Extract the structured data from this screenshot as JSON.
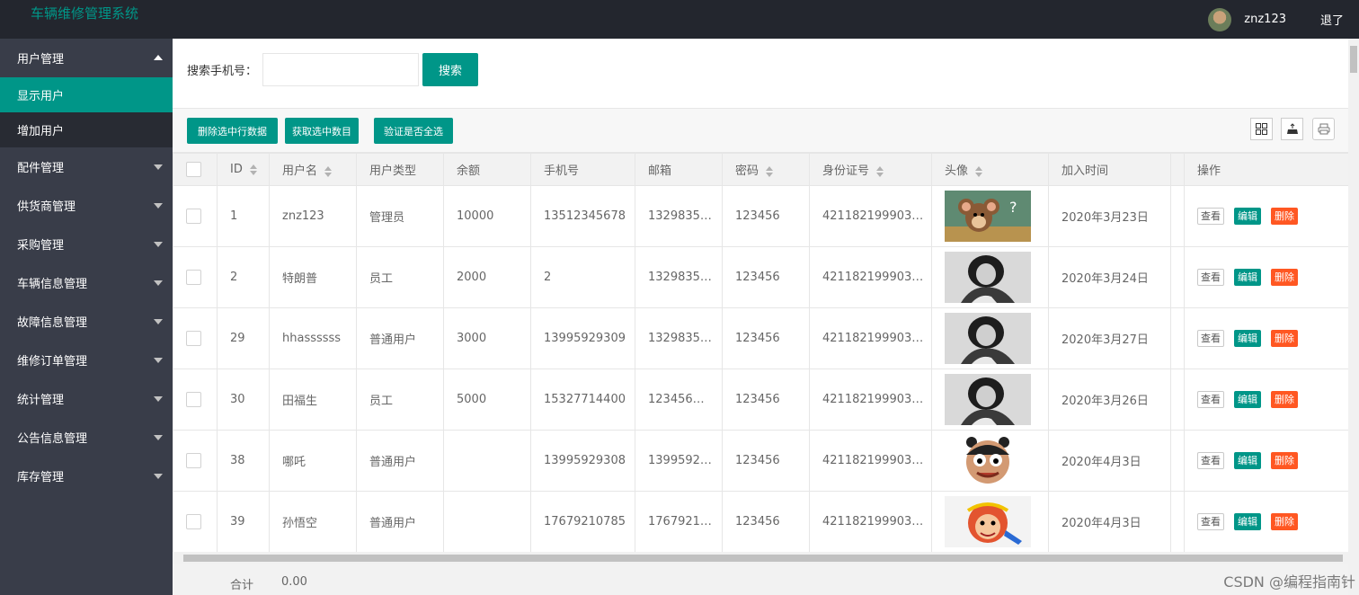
{
  "header": {
    "app_title": "车辆维修管理系统",
    "username": "znz123",
    "logout_label": "退了"
  },
  "sidebar": {
    "items": [
      {
        "label": "用户管理",
        "expanded": true,
        "children": [
          {
            "label": "显示用户",
            "active": true
          },
          {
            "label": "增加用户",
            "active": false
          }
        ]
      },
      {
        "label": "配件管理"
      },
      {
        "label": "供货商管理"
      },
      {
        "label": "采购管理"
      },
      {
        "label": "车辆信息管理"
      },
      {
        "label": "故障信息管理"
      },
      {
        "label": "维修订单管理"
      },
      {
        "label": "统计管理"
      },
      {
        "label": "公告信息管理"
      },
      {
        "label": "库存管理"
      }
    ]
  },
  "search": {
    "label": "搜索手机号：",
    "value": "",
    "button_label": "搜索"
  },
  "toolbar": {
    "delete_selected": "删除选中行数据",
    "get_selected_count": "获取选中数目",
    "check_all_selected": "验证是否全选",
    "icons": [
      "columns-filter-icon",
      "export-icon",
      "print-icon"
    ]
  },
  "table": {
    "columns": [
      "ID",
      "用户名",
      "用户类型",
      "余额",
      "手机号",
      "邮箱",
      "密码",
      "身份证号",
      "头像",
      "加入时间",
      "操作"
    ],
    "rows": [
      {
        "id": "1",
        "username": "znz123",
        "type": "管理员",
        "balance": "10000",
        "phone": "13512345678",
        "email": "1329835…",
        "password": "123456",
        "id_card": "421182199903…",
        "avatar": "jerry-mouse",
        "joined": "2020年3月23日"
      },
      {
        "id": "2",
        "username": "特朗普",
        "type": "员工",
        "balance": "2000",
        "phone": "2",
        "email": "1329835…",
        "password": "123456",
        "id_card": "421182199903…",
        "avatar": "bw-portrait",
        "joined": "2020年3月24日"
      },
      {
        "id": "29",
        "username": "hhassssss",
        "type": "普通用户",
        "balance": "3000",
        "phone": "13995929309",
        "email": "1329835…",
        "password": "123456",
        "id_card": "421182199903…",
        "avatar": "bw-portrait",
        "joined": "2020年3月27日"
      },
      {
        "id": "30",
        "username": "田福生",
        "type": "员工",
        "balance": "5000",
        "phone": "15327714400",
        "email": "123456…",
        "password": "123456",
        "id_card": "421182199903…",
        "avatar": "bw-portrait",
        "joined": "2020年3月26日"
      },
      {
        "id": "38",
        "username": "哪吒",
        "type": "普通用户",
        "balance": "",
        "phone": "13995929308",
        "email": "1399592…",
        "password": "123456",
        "id_card": "421182199903…",
        "avatar": "nezha-cartoon",
        "joined": "2020年4月3日"
      },
      {
        "id": "39",
        "username": "孙悟空",
        "type": "普通用户",
        "balance": "",
        "phone": "17679210785",
        "email": "1767921…",
        "password": "123456",
        "id_card": "421182199903…",
        "avatar": "monkey-king-cartoon",
        "joined": "2020年4月3日"
      }
    ],
    "actions": {
      "view": "查看",
      "edit": "编辑",
      "delete": "删除"
    },
    "footer": {
      "label": "合计",
      "value": "0.00"
    }
  },
  "watermark": "CSDN @编程指南针",
  "colors": {
    "accent": "#009688",
    "danger": "#ff5722",
    "topbar": "#23262e",
    "sidebar": "#393d49"
  }
}
